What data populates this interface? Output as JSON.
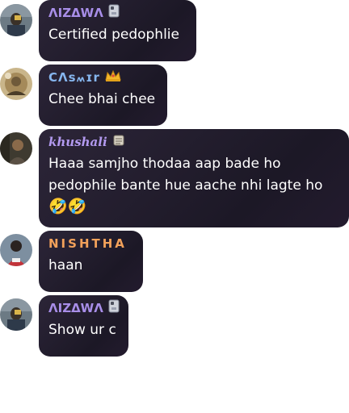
{
  "messages": [
    {
      "sender": "ΛIZΔWΛ",
      "sender_color": "#a88ee8",
      "badge_icon": "phone-case-icon",
      "text": "Certified pedophlie"
    },
    {
      "sender": "CΛs៳ɪr",
      "sender_color": "#86b6ee",
      "badge_icon": "crown-icon",
      "text": "Chee bhai chee"
    },
    {
      "sender": "khushali",
      "sender_color": "#b39af0",
      "badge_icon": "paper-scroll-icon",
      "text_lines": [
        "Haaa samjho thodaa aap bade ho",
        "pedophile bante hue aache nhi lagte ho"
      ],
      "emojis": "🤣🤣"
    },
    {
      "sender": "NISHTHA",
      "sender_color": "#f2a15a",
      "text": "haan"
    },
    {
      "sender": "ΛIZΔWΛ",
      "sender_color": "#a88ee8",
      "badge_icon": "phone-case-icon",
      "text": "Show ur c"
    }
  ]
}
